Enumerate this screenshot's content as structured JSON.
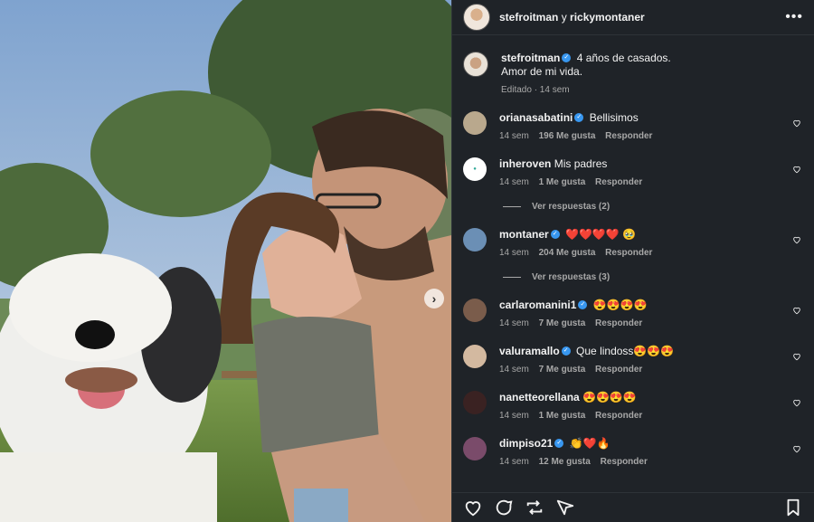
{
  "post": {
    "owners_primary": "stefroitman",
    "owners_joiner": "y",
    "owners_secondary": "rickymontaner",
    "more_label": "•••"
  },
  "caption": {
    "user": "stefroitman",
    "line1": "4 años de casados.",
    "line2": "Amor de mi vida.",
    "meta": "Editado · 14 sem"
  },
  "comments": [
    {
      "user": "orianasabatini",
      "verified": true,
      "text": "Bellisimos",
      "time": "14 sem",
      "likes": "196 Me gusta",
      "reply": "Responder"
    },
    {
      "user": "inheroven",
      "verified": false,
      "text": "Mis padres",
      "time": "14 sem",
      "likes": "1 Me gusta",
      "reply": "Responder",
      "view_replies": "Ver respuestas (2)"
    },
    {
      "user": "montaner",
      "verified": true,
      "text": "❤️❤️❤️❤️ 🥹",
      "time": "14 sem",
      "likes": "204 Me gusta",
      "reply": "Responder",
      "view_replies": "Ver respuestas (3)"
    },
    {
      "user": "carlaromanini1",
      "verified": true,
      "text": "😍😍😍😍",
      "time": "14 sem",
      "likes": "7 Me gusta",
      "reply": "Responder"
    },
    {
      "user": "valuramallo",
      "verified": true,
      "text": "Que lindoss😍😍😍",
      "time": "14 sem",
      "likes": "7 Me gusta",
      "reply": "Responder"
    },
    {
      "user": "nanetteorellana",
      "verified": false,
      "text": "😍😍😍😍",
      "time": "14 sem",
      "likes": "1 Me gusta",
      "reply": "Responder"
    },
    {
      "user": "dimpiso21",
      "verified": true,
      "text": "👏❤️🔥",
      "time": "14 sem",
      "likes": "12 Me gusta",
      "reply": "Responder"
    }
  ],
  "icons": {
    "like": "heart-icon",
    "comment": "comment-icon",
    "repost": "repost-icon",
    "share": "share-icon",
    "save": "bookmark-icon",
    "carousel_next": "chevron-right-icon"
  },
  "colors": {
    "panel_bg": "#1f2328",
    "verified": "#3897f0",
    "muted_text": "#a8a8a8"
  }
}
